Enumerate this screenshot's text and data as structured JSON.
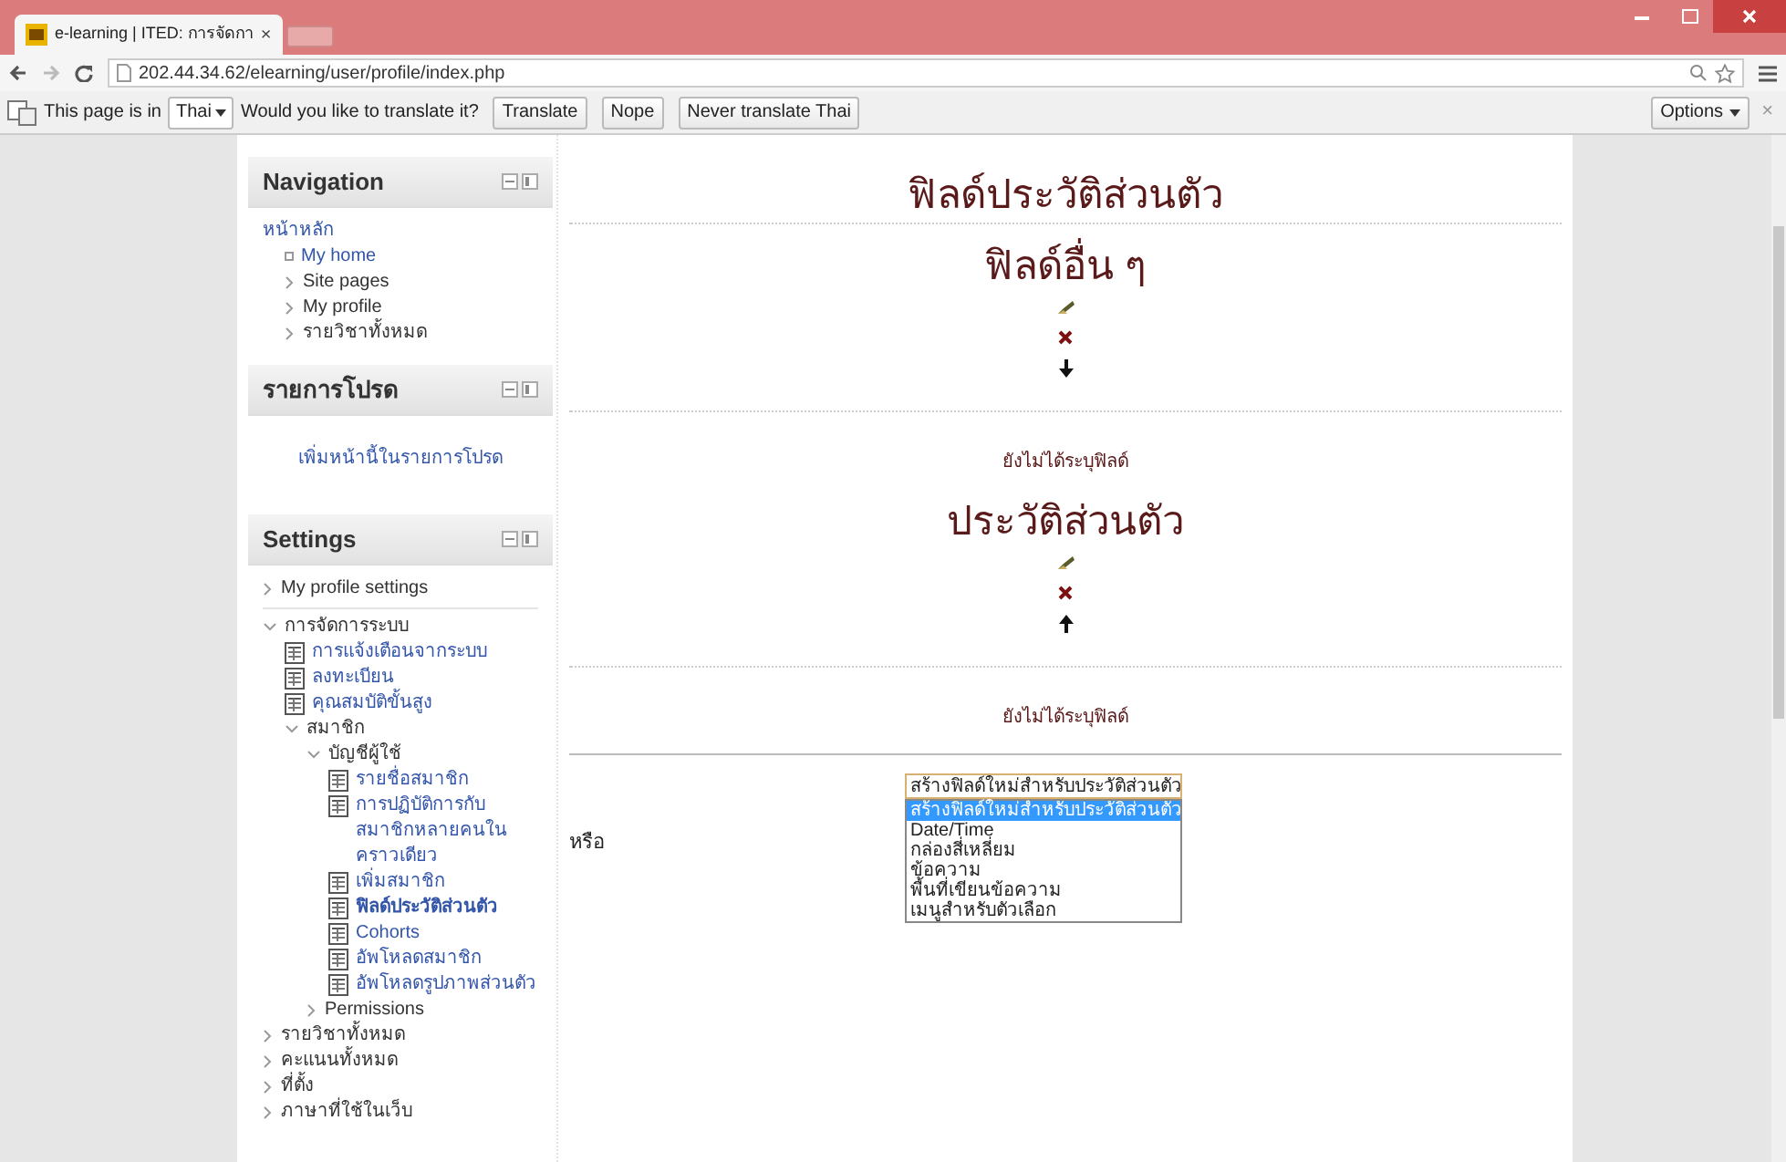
{
  "browser": {
    "tab_title": "e-learning | ITED: การจัดกา",
    "tab_close": "×",
    "url": "202.44.34.62/elearning/user/profile/index.php"
  },
  "translate_bar": {
    "prefix": "This page is in",
    "language": "Thai",
    "question": "Would you like to translate it?",
    "buttons": [
      "Translate",
      "Nope",
      "Never translate Thai"
    ],
    "options": "Options",
    "close": "×"
  },
  "sidebar": [
    {
      "title": "Navigation",
      "items": [
        {
          "label": "หน้าหลัก",
          "kind": "plain",
          "children": [
            {
              "label": "My home",
              "kind": "home"
            },
            {
              "label": "Site pages",
              "kind": "collapsed"
            },
            {
              "label": "My profile",
              "kind": "collapsed"
            },
            {
              "label": "รายวิชาทั้งหมด",
              "kind": "collapsed"
            }
          ]
        }
      ]
    },
    {
      "title": "รายการโปรด",
      "link": "เพิ่มหน้านี้ในรายการโปรด"
    },
    {
      "title": "Settings",
      "items": [
        {
          "label": "My profile settings",
          "kind": "collapsed"
        },
        {
          "label": "การจัดการระบบ",
          "kind": "expanded",
          "children": [
            {
              "label": "การแจ้งเตือนจากระบบ",
              "kind": "page",
              "selected": false
            },
            {
              "label": "ลงทะเบียน",
              "kind": "page",
              "selected": false
            },
            {
              "label": "คุณสมบัติขั้นสูง",
              "kind": "page",
              "selected": false
            },
            {
              "label": "สมาชิก",
              "kind": "expanded",
              "children": [
                {
                  "label": "บัญชีผู้ใช้",
                  "kind": "expanded",
                  "children": [
                    {
                      "label": "รายชื่อสมาชิก",
                      "kind": "page",
                      "selected": false
                    },
                    {
                      "label": "การปฏิบัติการกับสมาชิกหลายคนในคราวเดียว",
                      "kind": "page",
                      "selected": false
                    },
                    {
                      "label": "เพิ่มสมาชิก",
                      "kind": "page",
                      "selected": false
                    },
                    {
                      "label": "ฟิลด์ประวัติส่วนตัว",
                      "kind": "page",
                      "selected": true
                    },
                    {
                      "label": "Cohorts",
                      "kind": "page",
                      "selected": false
                    },
                    {
                      "label": "อัพโหลดสมาชิก",
                      "kind": "page",
                      "selected": false
                    },
                    {
                      "label": "อัพโหลดรูปภาพส่วนตัว",
                      "kind": "page",
                      "selected": false
                    }
                  ]
                },
                {
                  "label": "Permissions",
                  "kind": "collapsed"
                }
              ]
            }
          ]
        },
        {
          "label": "รายวิชาทั้งหมด",
          "kind": "collapsed"
        },
        {
          "label": "คะแนนทั้งหมด",
          "kind": "collapsed"
        },
        {
          "label": "ที่ตั้ง",
          "kind": "collapsed"
        },
        {
          "label": "ภาษาที่ใช้ในเว็บ",
          "kind": "collapsed"
        }
      ]
    }
  ],
  "main": {
    "title": "ฟิลด์ประวัติส่วนตัว",
    "categories": [
      {
        "name": "ฟิลด์อื่น ๆ",
        "actions": [
          {
            "kind": "edit"
          },
          {
            "kind": "delete"
          },
          {
            "kind": "down"
          }
        ],
        "empty": "ยังไม่ได้ระบุฟิลด์"
      },
      {
        "name": "ประวัติส่วนตัว",
        "actions": [
          {
            "kind": "edit"
          },
          {
            "kind": "delete"
          },
          {
            "kind": "up"
          }
        ],
        "empty": "ยังไม่ได้ระบุฟิลด์"
      }
    ],
    "create": {
      "label": "หรือ",
      "value": "สร้างฟิลด์ใหม่สำหรับประวัติส่วนตัว",
      "options": [
        {
          "label": "สร้างฟิลด์ใหม่สำหรับประวัติส่วนตัว",
          "selected": true
        },
        {
          "label": "Date/Time",
          "selected": false
        },
        {
          "label": "กล่องสี่เหลี่ยม",
          "selected": false
        },
        {
          "label": "ข้อความ",
          "selected": false
        },
        {
          "label": "พื้นที่เขียนข้อความ",
          "selected": false
        },
        {
          "label": "เมนูสำหรับตัวเลือก",
          "selected": false
        }
      ]
    }
  }
}
